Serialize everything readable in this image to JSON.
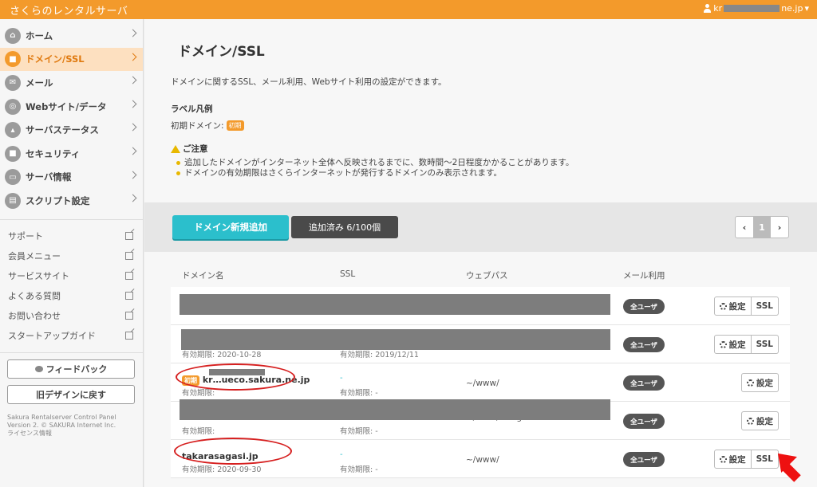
{
  "header": {
    "brand": "さくらのレンタルサーバ",
    "user": "kr",
    "user_suffix": "ne.jp"
  },
  "sidebar": {
    "nav": [
      {
        "label": "ホーム",
        "icon": "home-icon"
      },
      {
        "label": "ドメイン/SSL",
        "icon": "lock-icon"
      },
      {
        "label": "メール",
        "icon": "mail-icon"
      },
      {
        "label": "Webサイト/データ",
        "icon": "globe-icon"
      },
      {
        "label": "サーバステータス",
        "icon": "chart-icon"
      },
      {
        "label": "セキュリティ",
        "icon": "lock-icon"
      },
      {
        "label": "サーバ情報",
        "icon": "server-icon"
      },
      {
        "label": "スクリプト設定",
        "icon": "script-icon"
      }
    ],
    "links": [
      "サポート",
      "会員メニュー",
      "サービスサイト",
      "よくある質問",
      "お問い合わせ",
      "スタートアップガイド"
    ],
    "feedback": "フィードバック",
    "old_design": "旧デザインに戻す",
    "footer": [
      "Sakura Rentalserver Control Panel",
      "Version 2. © SAKURA Internet Inc.",
      "ライセンス情報"
    ]
  },
  "main": {
    "title": "ドメイン/SSL",
    "intro": "ドメインに関するSSL、メール利用、Webサイト利用の設定ができます。",
    "legend_heading": "ラベル凡例",
    "legend_text": "初期ドメイン:",
    "badge_initial": "初期",
    "notice_heading": "ご注意",
    "notices": [
      "追加したドメインがインターネット全体へ反映されるまでに、数時間〜2日程度かかることがあります。",
      "ドメインの有効期限はさくらインターネットが発行するドメインのみ表示されます。"
    ],
    "add_button": "ドメイン新規追加",
    "count": "追加済み 6/100個",
    "pager": {
      "prev": "‹",
      "page": "1",
      "next": "›"
    },
    "columns": [
      "ドメイン名",
      "SSL",
      "ウェブパス",
      "メール利用"
    ],
    "settings_label": "設定",
    "ssl_label": "SSL",
    "mail_all": "全ユーザ",
    "rows": [
      {
        "domain": "",
        "expiry": "",
        "ssl": "",
        "ssl_expiry": "",
        "path": "",
        "ssl_btn": true
      },
      {
        "domain": "",
        "expiry": "有効期限: 2020-10-28",
        "ssl": "",
        "ssl_expiry": "有効期限: 2019/12/11",
        "path": "",
        "ssl_btn": true
      },
      {
        "domain": "kr…ueco.sakura.ne.jp",
        "expiry": "有効期限:",
        "ssl": "-",
        "ssl_expiry": "有効期限: -",
        "path": "~/www/",
        "ssl_btn": false
      },
      {
        "domain": "",
        "expiry": "有効期限:",
        "ssl": "",
        "ssl_expiry": "有効期限: -",
        "path": "~/www/shingo",
        "ssl_btn": false
      },
      {
        "domain": "takarasagasi.jp",
        "expiry": "有効期限: 2020-09-30",
        "ssl": "-",
        "ssl_expiry": "有効期限: -",
        "path": "~/www/",
        "ssl_btn": true
      }
    ]
  }
}
